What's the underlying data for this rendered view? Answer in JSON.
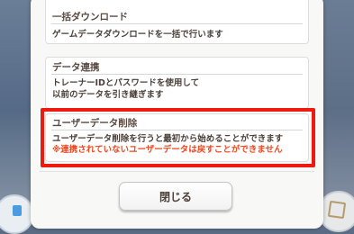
{
  "cards": [
    {
      "title": "一括ダウンロード",
      "lines": [
        "ゲームデータダウンロードを一括で行います"
      ]
    },
    {
      "title": "データ連携",
      "lines": [
        "トレーナーIDとパスワードを使用して",
        "以前のデータを引き継ぎます"
      ]
    },
    {
      "title": "ユーザーデータ削除",
      "lines": [
        "ユーザーデータ削除を行うと最初から始めることができます"
      ],
      "warning": "※連携されていないユーザーデータは戻すことができません"
    }
  ],
  "close_button": {
    "label": "閉じる"
  },
  "colors": {
    "highlight": "#ee1a10",
    "warning_text": "#f0461e",
    "text": "#4a3e38"
  }
}
